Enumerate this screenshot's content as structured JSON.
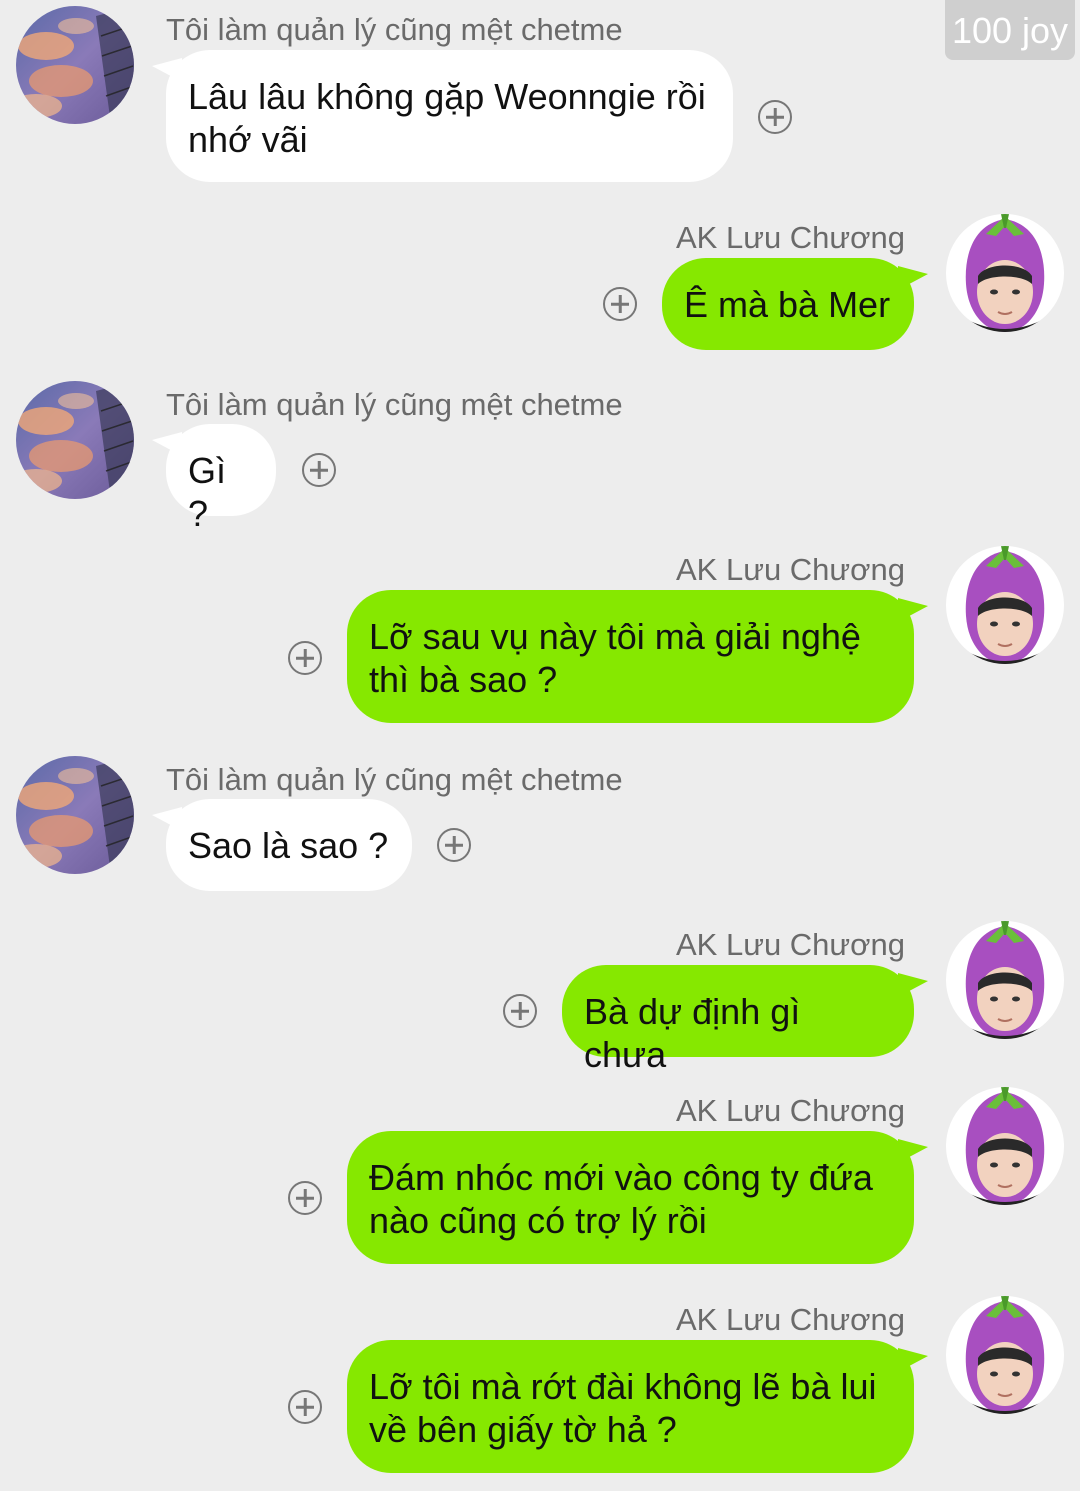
{
  "header": {
    "joy_badge": "100 joy"
  },
  "contacts": {
    "left_name": "Tôi làm quản lý cũng mệt chetme",
    "right_name": "AK Lưu Chương"
  },
  "messages": [
    {
      "side": "left",
      "lines": [
        "Lâu lâu không gặp Weonngie rồi",
        "nhớ vãi"
      ]
    },
    {
      "side": "right",
      "lines": [
        "Ê mà bà Mer"
      ]
    },
    {
      "side": "left",
      "lines": [
        "Gì ?"
      ]
    },
    {
      "side": "right",
      "lines": [
        "Lỡ sau vụ này tôi mà giải nghệ",
        "thì bà sao ?"
      ]
    },
    {
      "side": "left",
      "lines": [
        "Sao là sao ?"
      ]
    },
    {
      "side": "right",
      "lines": [
        "Bà dự định gì chưa"
      ]
    },
    {
      "side": "right",
      "lines": [
        "Đám nhóc mới vào công ty đứa",
        "nào cũng có trợ lý rồi"
      ]
    },
    {
      "side": "right",
      "lines": [
        "Lỡ tôi mà rớt đài không lẽ bà lui",
        "về bên giấy tờ hả ?"
      ]
    }
  ],
  "colors": {
    "background": "#ededed",
    "left_bubble": "#ffffff",
    "right_bubble": "#86e800",
    "badge": "#cfcfcf"
  },
  "icons": {
    "left_avatar": "sunset-clouds-avatar",
    "right_avatar": "eggplant-hat-avatar",
    "add_reaction": "plus-circle-icon"
  }
}
